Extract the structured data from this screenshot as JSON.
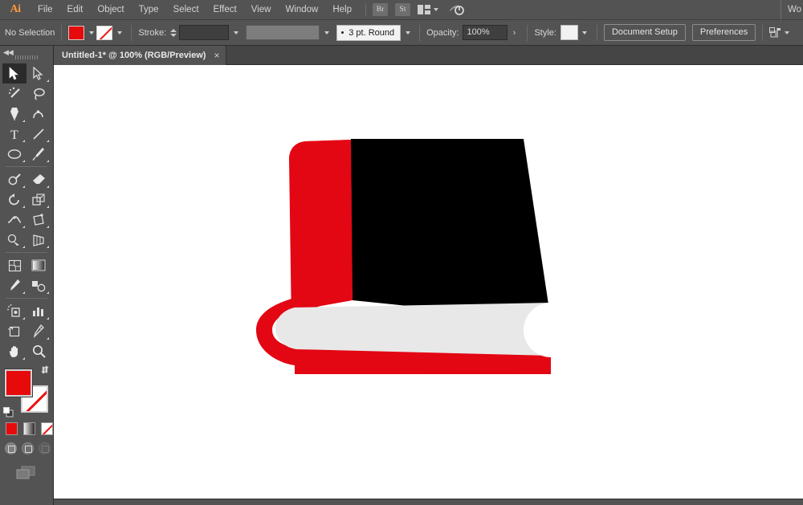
{
  "app": {
    "name": "Adobe Illustrator",
    "logo_text": "Ai"
  },
  "menubar": {
    "items": [
      {
        "label": "File"
      },
      {
        "label": "Edit"
      },
      {
        "label": "Object"
      },
      {
        "label": "Type"
      },
      {
        "label": "Select"
      },
      {
        "label": "Effect"
      },
      {
        "label": "View"
      },
      {
        "label": "Window"
      },
      {
        "label": "Help"
      }
    ],
    "bridge_badge": "Br",
    "stock_badge": "St",
    "arrange_icon": "arrange-documents-icon",
    "arrange_chevron": "chevron-down-icon",
    "power_icon": "power-sync-icon",
    "workspace_label": "Wo"
  },
  "controlbar": {
    "selection_status": "No Selection",
    "fill_swatch_color": "#e60a0a",
    "fill_icon": "fill-color-swatch",
    "stroke_swatch_icon": "stroke-none-swatch",
    "stroke_label": "Stroke:",
    "stroke_weight_value": "",
    "stroke_profile_value": "",
    "brush_definition": "3 pt. Round",
    "opacity_label": "Opacity:",
    "opacity_value": "100%",
    "style_label": "Style:",
    "style_swatch_color": "#f2f2f2",
    "document_setup_label": "Document Setup",
    "preferences_label": "Preferences",
    "align_icon": "align-to-artboard-icon",
    "align_chevron": "chevron-down-icon"
  },
  "tabbar": {
    "document_tab": {
      "title": "Untitled-1* @ 100% (RGB/Preview)",
      "close_label": "×"
    }
  },
  "toolbar": {
    "collapse_icon": "collapse-panel-icon",
    "grip_icon": "drag-handle-icon",
    "tools": [
      {
        "name": "selection-tool",
        "label": "Selection",
        "active": true,
        "more": false
      },
      {
        "name": "direct-selection-tool",
        "label": "Direct Selection",
        "active": false,
        "more": true
      },
      {
        "name": "magic-wand-tool",
        "label": "Magic Wand",
        "active": false,
        "more": false
      },
      {
        "name": "lasso-tool",
        "label": "Lasso",
        "active": false,
        "more": false
      },
      {
        "name": "pen-tool",
        "label": "Pen",
        "active": false,
        "more": true
      },
      {
        "name": "curvature-tool",
        "label": "Curvature",
        "active": false,
        "more": false
      },
      {
        "name": "type-tool",
        "label": "Type",
        "active": false,
        "more": true
      },
      {
        "name": "line-segment-tool",
        "label": "Line Segment",
        "active": false,
        "more": true
      },
      {
        "name": "ellipse-tool",
        "label": "Ellipse",
        "active": false,
        "more": true
      },
      {
        "name": "paintbrush-tool",
        "label": "Paintbrush",
        "active": false,
        "more": true
      },
      {
        "name": "shaper-tool",
        "label": "Shaper",
        "active": false,
        "more": true
      },
      {
        "name": "eraser-tool",
        "label": "Eraser",
        "active": false,
        "more": true
      },
      {
        "name": "rotate-tool",
        "label": "Rotate",
        "active": false,
        "more": true
      },
      {
        "name": "scale-tool",
        "label": "Scale",
        "active": false,
        "more": true
      },
      {
        "name": "width-tool",
        "label": "Width",
        "active": false,
        "more": true
      },
      {
        "name": "free-transform-tool",
        "label": "Free Transform",
        "active": false,
        "more": false
      },
      {
        "name": "shape-builder-tool",
        "label": "Shape Builder",
        "active": false,
        "more": true
      },
      {
        "name": "perspective-grid-tool",
        "label": "Perspective Grid",
        "active": false,
        "more": true
      },
      {
        "name": "mesh-tool",
        "label": "Mesh",
        "active": false,
        "more": false
      },
      {
        "name": "gradient-tool",
        "label": "Gradient",
        "active": false,
        "more": false
      },
      {
        "name": "eyedropper-tool",
        "label": "Eyedropper",
        "active": false,
        "more": true
      },
      {
        "name": "blend-tool",
        "label": "Blend",
        "active": false,
        "more": true
      },
      {
        "name": "symbol-sprayer-tool",
        "label": "Symbol Sprayer",
        "active": false,
        "more": true
      },
      {
        "name": "column-graph-tool",
        "label": "Column Graph",
        "active": false,
        "more": true
      },
      {
        "name": "artboard-tool",
        "label": "Artboard",
        "active": false,
        "more": false
      },
      {
        "name": "slice-tool",
        "label": "Slice",
        "active": false,
        "more": true
      },
      {
        "name": "hand-tool",
        "label": "Hand",
        "active": false,
        "more": true
      },
      {
        "name": "zoom-tool",
        "label": "Zoom",
        "active": false,
        "more": false
      }
    ],
    "fill_color": "#e60a0a",
    "stroke_color": "none",
    "fill_icon": "fill-swatch",
    "stroke_icon": "stroke-swatch-none",
    "swap_icon": "swap-fill-stroke-icon",
    "default_icon": "default-fill-stroke-icon",
    "color_mode_icon": "color-mode-button",
    "gradient_mode_icon": "gradient-mode-button",
    "none_mode_icon": "none-mode-button",
    "draw_normal_icon": "draw-normal-button",
    "draw_behind_icon": "draw-behind-button",
    "draw_inside_icon": "draw-inside-button",
    "screen_mode_icon": "change-screen-mode-button"
  },
  "canvas": {
    "background": "#ffffff",
    "artwork": {
      "name": "closed-book-illustration",
      "description": "Closed hardcover book drawn in perspective",
      "colors": {
        "cover_red": "#e30613",
        "cover_black": "#000000",
        "pages_gray": "#e8e8e8",
        "page_notch": "#ffffff"
      }
    }
  }
}
